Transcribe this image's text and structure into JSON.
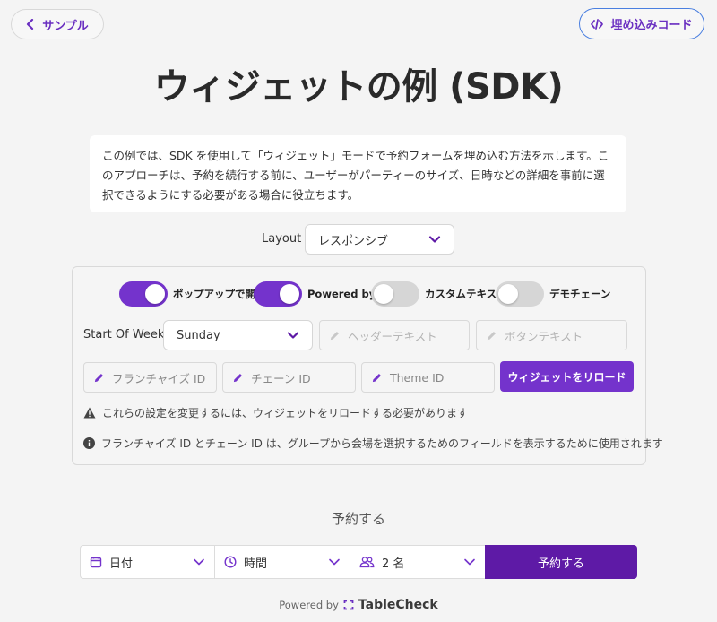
{
  "header": {
    "back_label": "サンプル",
    "embed_label": "埋め込みコード"
  },
  "page_title": "ウィジェットの例 (SDK)",
  "description": "この例では、SDK を使用して「ウィジェット」モードで予約フォームを埋め込む方法を示します。このアプローチは、予約を続行する前に、ユーザーがパーティーのサイズ、日時などの詳細を事前に選択できるようにする必要がある場合に役立ちます。",
  "layout": {
    "label": "Layout",
    "selected": "レスポンシブ"
  },
  "settings": {
    "toggles": [
      {
        "label": "ポップアップで開く",
        "on": true
      },
      {
        "label": "Powered by",
        "on": true
      },
      {
        "label": "カスタムテキスト",
        "on": false
      },
      {
        "label": "デモチェーン",
        "on": false
      }
    ],
    "start_of_week": {
      "label": "Start Of Week",
      "selected": "Sunday"
    },
    "header_text_placeholder": "ヘッダーテキスト",
    "button_text_placeholder": "ボタンテキスト",
    "franchise_id_placeholder": "フランチャイズ ID",
    "chain_id_placeholder": "チェーン ID",
    "theme_id_placeholder": "Theme ID",
    "reload_label": "ウィジェットをリロード",
    "warning_note": "これらの設定を変更するには、ウィジェットをリロードする必要があります",
    "info_note": "フランチャイズ ID とチェーン ID は、グループから会場を選択するためのフィールドを表示するために使用されます"
  },
  "booking": {
    "heading": "予約する",
    "date_label": "日付",
    "time_label": "時間",
    "party_label": "2 名",
    "submit_label": "予約する"
  },
  "footer": {
    "powered_by": "Powered by",
    "brand": "TableCheck"
  },
  "colors": {
    "accent": "#7433cc",
    "accent_dark": "#5e1aa6",
    "embed_border": "#4a7fe0"
  }
}
